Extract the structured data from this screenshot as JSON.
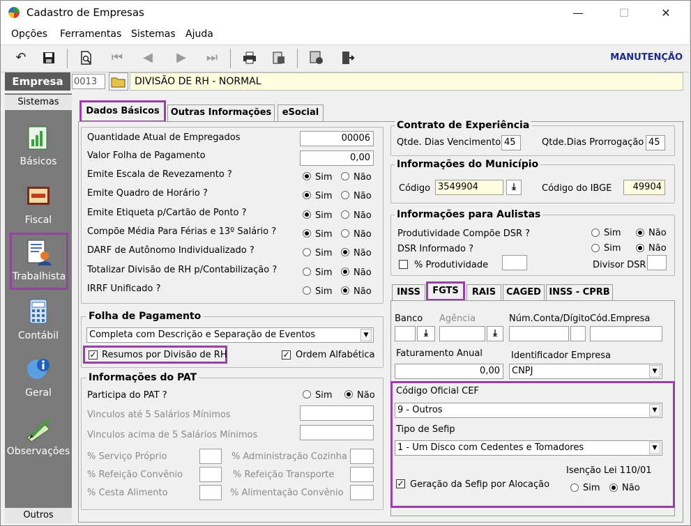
{
  "window": {
    "title": "Cadastro de Empresas",
    "minimize": "—",
    "maximize": "☐",
    "close": "✕"
  },
  "menu": [
    "Opções",
    "Ferramentas",
    "Sistemas",
    "Ajuda"
  ],
  "toolbar": {
    "mode_label": "MANUTENÇÃO"
  },
  "empresa": {
    "label": "Empresa",
    "code": "0013",
    "name": "DIVISÃO DE RH - NORMAL"
  },
  "sidebar": {
    "header": "Sistemas",
    "footer": "Outros",
    "items": [
      {
        "label": "Básicos",
        "icon": "document-chart-icon"
      },
      {
        "label": "Fiscal",
        "icon": "fiscal-book-icon"
      },
      {
        "label": "Trabalhista",
        "icon": "worker-document-icon"
      },
      {
        "label": "Contábil",
        "icon": "calculator-icon"
      },
      {
        "label": "Geral",
        "icon": "info-globe-icon"
      },
      {
        "label": "Observações",
        "icon": "pen-note-icon"
      }
    ]
  },
  "tabs": [
    "Dados Básicos",
    "Outras Informações",
    "eSocial"
  ],
  "basic": {
    "rows": [
      {
        "label": "Quantidade Atual de Empregados",
        "value": "00006"
      },
      {
        "label": "Valor Folha de Pagamento",
        "value": "0,00"
      }
    ],
    "radios": [
      {
        "label": "Emite Escala de Revezamento ?",
        "selected": "Sim"
      },
      {
        "label": "Emite Quadro de Horário ?",
        "selected": "Sim"
      },
      {
        "label": "Emite Etiqueta p/Cartão de Ponto ?",
        "selected": "Sim"
      },
      {
        "label": "Compõe Média Para Férias e 13º Salário ?",
        "selected": "Sim"
      },
      {
        "label": "DARF de Autônomo Individualizado ?",
        "selected": "Não"
      },
      {
        "label": "Totalizar Divisão de RH p/Contabilização ?",
        "selected": "Não"
      },
      {
        "label": "IRRF Unificado ?",
        "selected": "Não"
      }
    ],
    "sim": "Sim",
    "nao": "Não"
  },
  "folha": {
    "title": "Folha de Pagamento",
    "select": "Completa com Descrição e Separação de Eventos",
    "resumos": "Resumos por Divisão de RH",
    "ordem": "Ordem Alfabética"
  },
  "pat": {
    "title": "Informações do PAT",
    "participa": "Participa do PAT ?",
    "participa_selected": "Não",
    "vinc5": "Vinculos até 5 Salários Mínimos",
    "vincAcima": "Vinculos acima de 5 Salários Mínimos",
    "servico": "% Serviço Próprio",
    "adminCozinha": "% Administração Cozinha",
    "refeicaoConvenio": "% Refeição Convênio",
    "refeicaoTransporte": "% Refeição Transporte",
    "cestaAlimento": "% Cesta Alimento",
    "alimentacaoConvenio": "% Alimentação Convênio"
  },
  "contrato": {
    "title": "Contrato de Experiência",
    "vencLabel": "Qtde. Dias Vencimento",
    "vencValue": "45",
    "prorrLabel": "Qtde.Dias Prorrogação",
    "prorrValue": "45"
  },
  "municipio": {
    "title": "Informações do Município",
    "codigoLabel": "Código",
    "codigoValue": "3549904",
    "ibgeLabel": "Código do IBGE",
    "ibgeValue": "49904"
  },
  "aulistas": {
    "title": "Informações para Aulistas",
    "prodLabel": "Produtividade Compõe DSR ?",
    "prodSelected": "Não",
    "dsrLabel": "DSR Informado ?",
    "dsrSelected": "Não",
    "pctLabel": "% Produtividade",
    "divisorLabel": "Divisor DSR"
  },
  "subtabs": [
    "INSS",
    "FGTS",
    "RAIS",
    "CAGED",
    "INSS - CPRB"
  ],
  "fgts": {
    "banco": "Banco",
    "agencia": "Agência",
    "conta": "Núm.Conta/Dígito",
    "codEmpresa": "Cód.Empresa",
    "faturamento": "Faturamento Anual",
    "faturamentoValue": "0,00",
    "identificador": "Identificador Empresa",
    "identificadorValue": "CNPJ",
    "cefLabel": "Código Oficial CEF",
    "cefValue": "9 - Outros",
    "sefipLabel": "Tipo de Sefip",
    "sefipValue": "1 - Um Disco com Cedentes e Tomadores",
    "geracao": "Geração da Sefip por Alocação",
    "isencao": "Isenção Lei 110/01",
    "isencaoSelected": "Não"
  }
}
